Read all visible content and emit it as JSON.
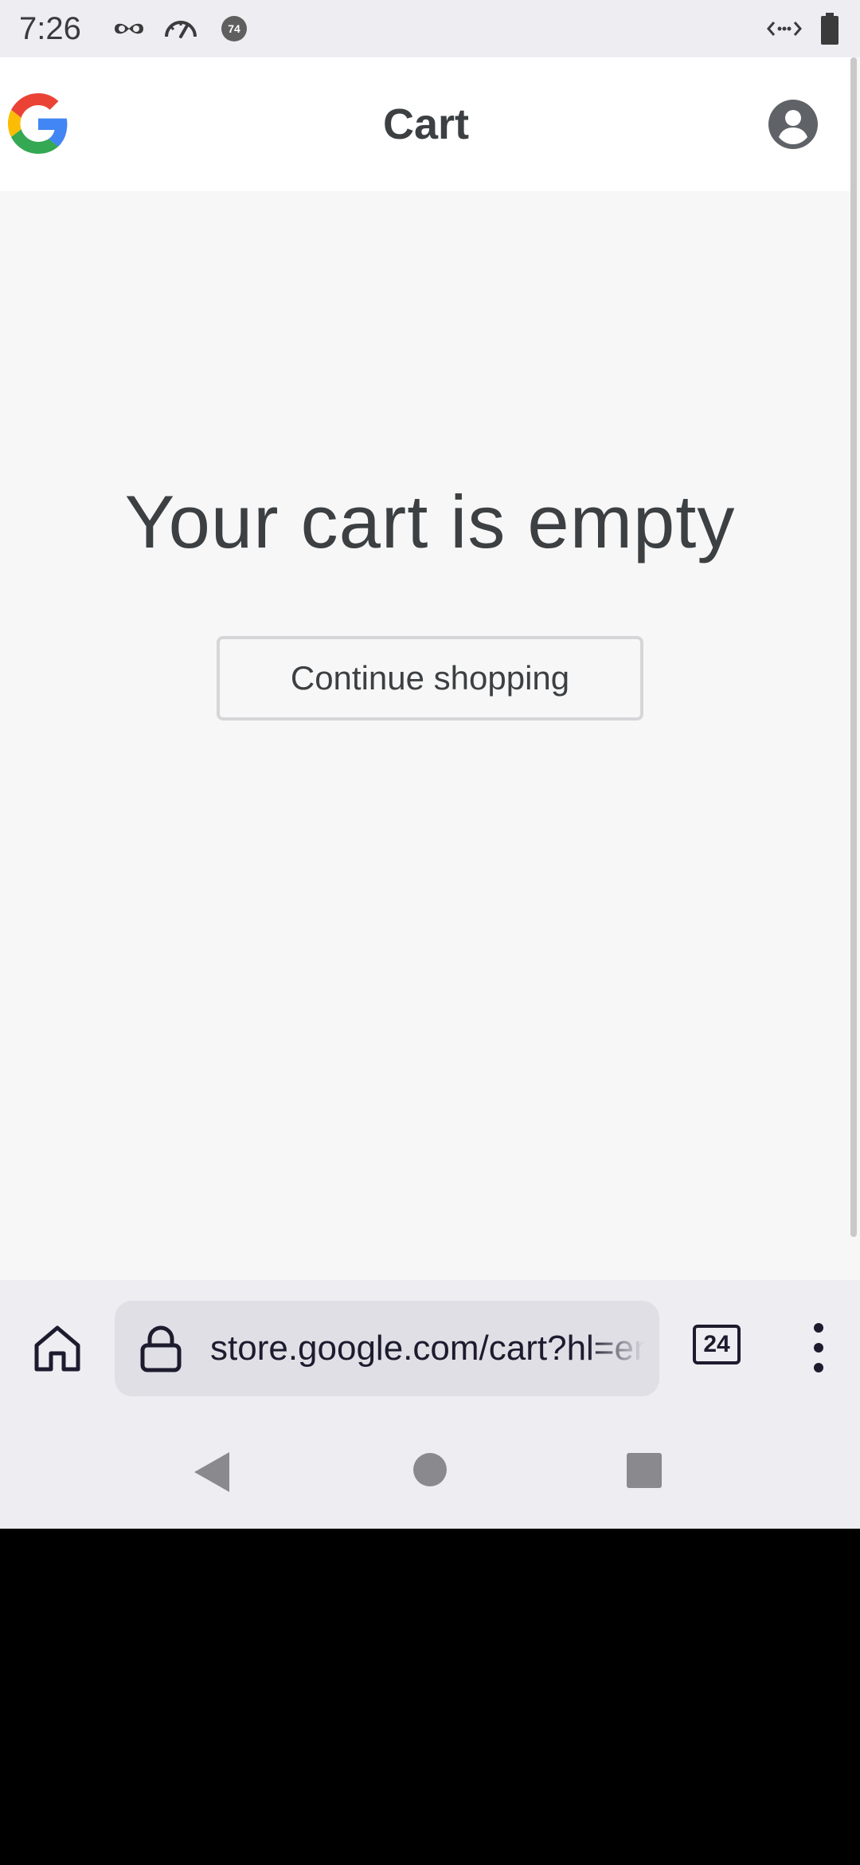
{
  "status_bar": {
    "time": "7:26",
    "icons": [
      "incognito-icon",
      "speedometer-icon",
      "notification-badge-icon",
      "data-saver-icon",
      "battery-icon"
    ],
    "badge_number": "74"
  },
  "header": {
    "logo": "google-g-logo",
    "title": "Cart",
    "account_icon": "account-circle-icon"
  },
  "main": {
    "empty_message": "Your cart is empty",
    "continue_button_label": "Continue shopping"
  },
  "browser_toolbar": {
    "home_icon": "home-icon",
    "lock_icon": "lock-icon",
    "url": "store.google.com/cart?hl=en",
    "tab_count": "24",
    "menu_icon": "more-vert-icon"
  },
  "nav_bar": {
    "buttons": [
      "back-icon",
      "home-circle-icon",
      "recents-square-icon"
    ]
  },
  "colors": {
    "page_bg": "#f7f7f7",
    "header_bg": "#ffffff",
    "chrome_bg": "#eeedf2",
    "url_bar_bg": "#e0dfe5",
    "text_primary": "#3c4043",
    "button_border": "#d6d6d9"
  }
}
